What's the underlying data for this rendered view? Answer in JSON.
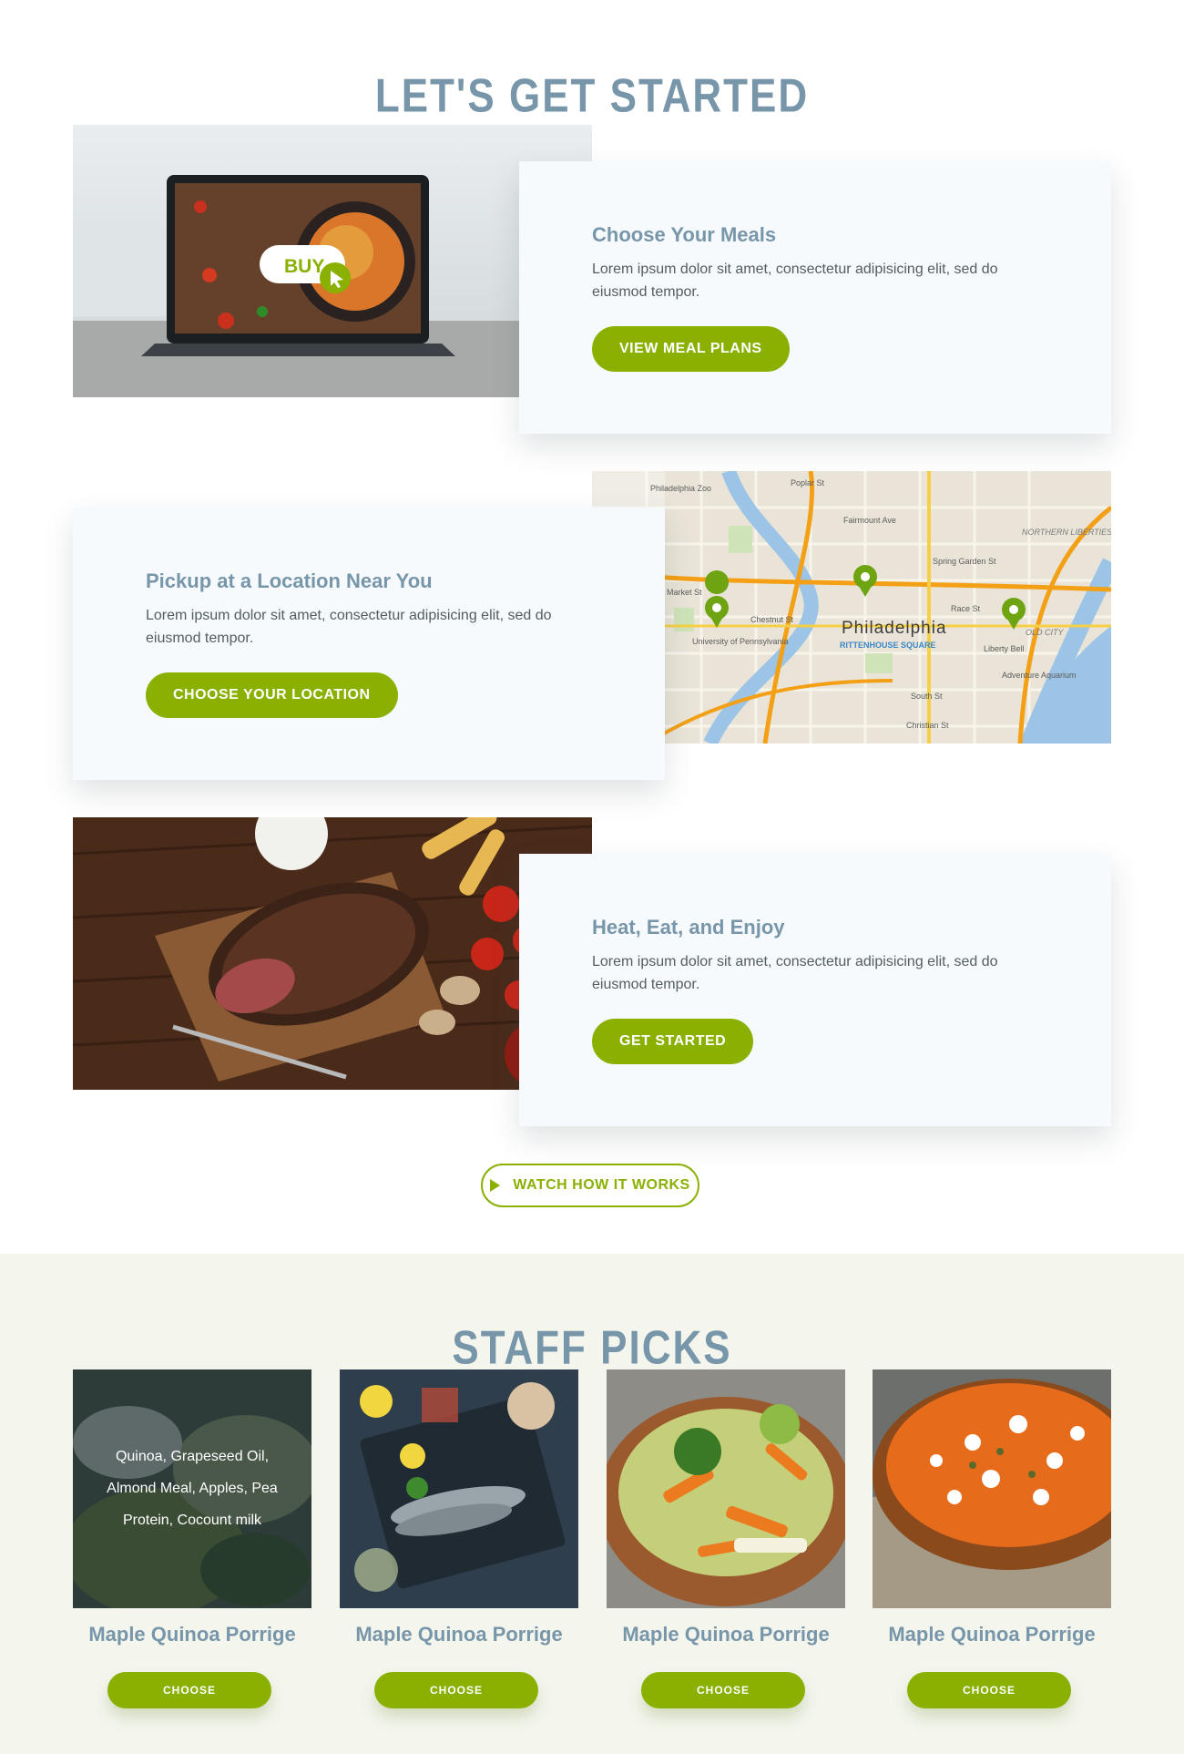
{
  "section_started": {
    "title": "LET'S GET STARTED",
    "steps": [
      {
        "title": "Choose Your Meals",
        "text": "Lorem ipsum dolor sit amet, consectetur adipisicing elit, sed do eiusmod tempor.",
        "button": "VIEW MEAL PLANS",
        "image_overlay": "BUY"
      },
      {
        "title": "Pickup at a Location Near You",
        "text": "Lorem ipsum dolor sit amet, consectetur adipisicing elit, sed do eiusmod tempor.",
        "button": "CHOOSE YOUR LOCATION",
        "map_labels": {
          "city": "Philadelphia",
          "zoo": "Philadelphia Zoo",
          "university": "University of Pennsylvania",
          "square": "RITTENHOUSE SQUARE",
          "liberty": "Liberty Bell",
          "aquarium": "Adventure Aquarium",
          "fairmount": "Fairmount Ave",
          "spring": "Spring Garden St",
          "market": "Market St",
          "chestnut": "Chestnut St",
          "race": "Race St",
          "south": "South St",
          "christian": "Christian St",
          "poplar": "Poplar St",
          "liberties": "NORTHERN LIBERTIES",
          "oldcity": "OLD CITY"
        }
      },
      {
        "title": "Heat, Eat, and Enjoy",
        "text": "Lorem ipsum dolor sit amet, consectetur adipisicing elit, sed do eiusmod tempor.",
        "button": "GET STARTED"
      }
    ],
    "watch_button": "WATCH HOW IT WORKS"
  },
  "staff_picks": {
    "title": "STAFF PICKS",
    "items": [
      {
        "name": "Maple Quinoa Porrige",
        "button": "CHOOSE",
        "overlay": "Quinoa, Grapeseed Oil, Almond Meal, Apples, Pea Protein, Cocount milk"
      },
      {
        "name": "Maple Quinoa Porrige",
        "button": "CHOOSE"
      },
      {
        "name": "Maple Quinoa Porrige",
        "button": "CHOOSE"
      },
      {
        "name": "Maple Quinoa Porrige",
        "button": "CHOOSE"
      }
    ]
  },
  "colors": {
    "accent_green": "#8ab001",
    "heading_blue": "#7896a9",
    "card_bg": "#f6fafc",
    "picks_bg": "#f4f6ee"
  }
}
